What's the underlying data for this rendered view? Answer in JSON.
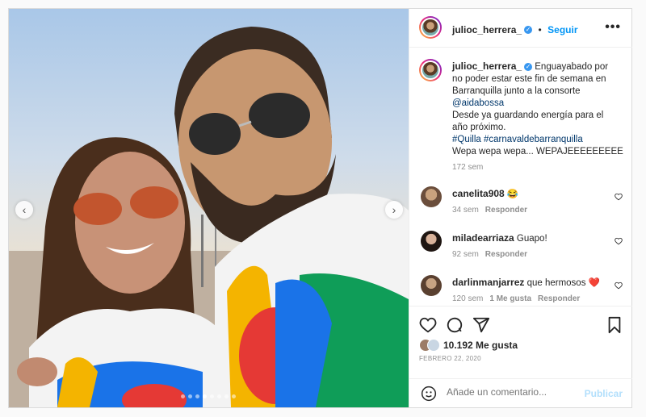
{
  "post": {
    "username": "julioc_herrera_",
    "follow_label": "Seguir",
    "more_label": "•••",
    "caption_lines": [
      "Enguayabado por",
      "no poder estar este fin de semana en",
      "Barranquilla junto a la consorte"
    ],
    "caption_mention": "@aidabossa",
    "caption_lines2": [
      "Desde ya guardando energía para el",
      "año próximo."
    ],
    "caption_tags": "#Quilla #carnavaldebarranquilla",
    "caption_last": "Wepa wepa wepa... WEPAJEEEEEEEEE",
    "caption_time": "172 sem"
  },
  "comments": [
    {
      "user": "canelita908",
      "text": "😂",
      "time": "34 sem",
      "likes": "",
      "reply": "Responder"
    },
    {
      "user": "miladearriaza",
      "text": "Guapo!",
      "time": "92 sem",
      "likes": "",
      "reply": "Responder"
    },
    {
      "user": "darlinmanjarrez",
      "text": "que hermosos ❤️",
      "time": "120 sem",
      "likes": "1 Me gusta",
      "reply": "Responder"
    }
  ],
  "likes_label": "10.192 Me gusta",
  "date_label": "FEBRERO 22, 2020",
  "comment_placeholder": "Añade un comentario...",
  "publish_label": "Publicar",
  "carousel": {
    "count": 8,
    "active": 3
  },
  "colors": {
    "accent": "#0095f6",
    "verified": "#3897f0",
    "heart": "#ed4956"
  }
}
